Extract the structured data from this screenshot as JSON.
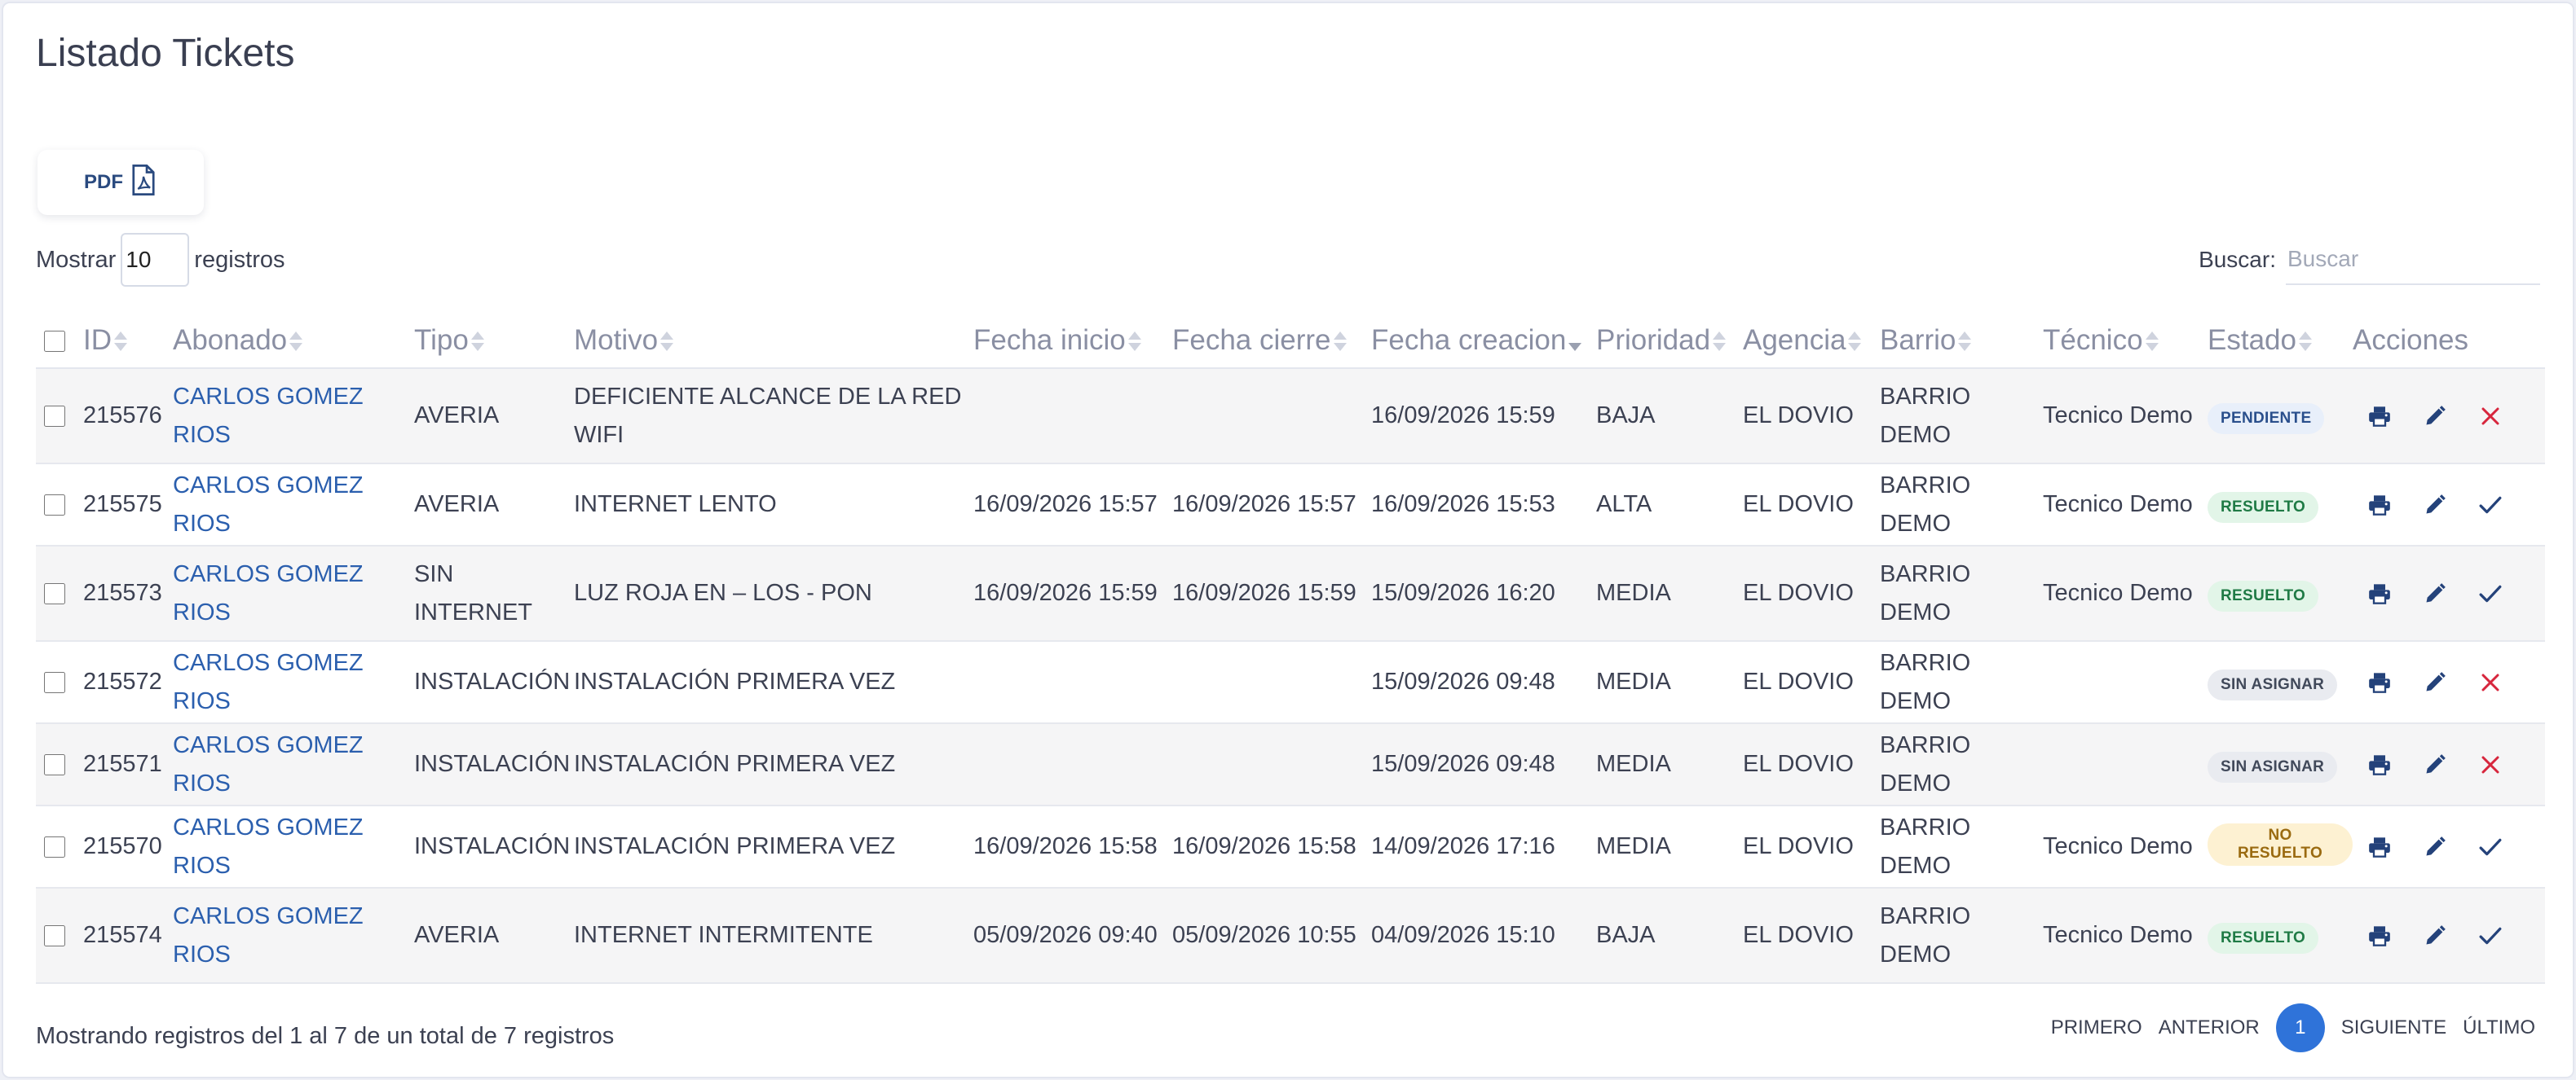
{
  "page": {
    "title": "Listado Tickets"
  },
  "toolbar": {
    "pdf_label": "PDF"
  },
  "length": {
    "prefix": "Mostrar",
    "value": "10",
    "suffix": "registros"
  },
  "search": {
    "label": "Buscar:",
    "placeholder": "Buscar"
  },
  "table": {
    "columns": [
      "ID",
      "Abonado",
      "Tipo",
      "Motivo",
      "Fecha inicio",
      "Fecha cierre",
      "Fecha creacion",
      "Prioridad",
      "Agencia",
      "Barrio",
      "Técnico",
      "Estado",
      "Acciones"
    ],
    "rows": [
      {
        "id": "215576",
        "abonado": "CARLOS GOMEZ RIOS",
        "tipo": "AVERIA",
        "motivo": "DEFICIENTE ALCANCE DE LA RED WIFI",
        "inicio": "",
        "cierre": "",
        "creacion": "16/09/2026 15:59",
        "prioridad": "BAJA",
        "agencia": "EL DOVIO",
        "barrio": "BARRIO DEMO",
        "tecnico": "Tecnico Demo",
        "estado": "PENDIENTE",
        "estado_kind": "pend",
        "accion_final": "close"
      },
      {
        "id": "215575",
        "abonado": "CARLOS GOMEZ RIOS",
        "tipo": "AVERIA",
        "motivo": "INTERNET LENTO",
        "inicio": "16/09/2026 15:57",
        "cierre": "16/09/2026 15:57",
        "creacion": "16/09/2026 15:53",
        "prioridad": "ALTA",
        "agencia": "EL DOVIO",
        "barrio": "BARRIO DEMO",
        "tecnico": "Tecnico Demo",
        "estado": "RESUELTO",
        "estado_kind": "res",
        "accion_final": "check"
      },
      {
        "id": "215573",
        "abonado": "CARLOS GOMEZ RIOS",
        "tipo": "SIN INTERNET",
        "motivo": "LUZ ROJA EN – LOS - PON",
        "inicio": "16/09/2026 15:59",
        "cierre": "16/09/2026 15:59",
        "creacion": "15/09/2026 16:20",
        "prioridad": "MEDIA",
        "agencia": "EL DOVIO",
        "barrio": "BARRIO DEMO",
        "tecnico": "Tecnico Demo",
        "estado": "RESUELTO",
        "estado_kind": "res",
        "accion_final": "check"
      },
      {
        "id": "215572",
        "abonado": "CARLOS GOMEZ RIOS",
        "tipo": "INSTALACIÓN",
        "motivo": "INSTALACIÓN PRIMERA VEZ",
        "inicio": "",
        "cierre": "",
        "creacion": "15/09/2026 09:48",
        "prioridad": "MEDIA",
        "agencia": "EL DOVIO",
        "barrio": "BARRIO DEMO",
        "tecnico": "",
        "estado": "SIN ASIGNAR",
        "estado_kind": "sin",
        "accion_final": "close"
      },
      {
        "id": "215571",
        "abonado": "CARLOS GOMEZ RIOS",
        "tipo": "INSTALACIÓN",
        "motivo": "INSTALACIÓN PRIMERA VEZ",
        "inicio": "",
        "cierre": "",
        "creacion": "15/09/2026 09:48",
        "prioridad": "MEDIA",
        "agencia": "EL DOVIO",
        "barrio": "BARRIO DEMO",
        "tecnico": "",
        "estado": "SIN ASIGNAR",
        "estado_kind": "sin",
        "accion_final": "close"
      },
      {
        "id": "215570",
        "abonado": "CARLOS GOMEZ RIOS",
        "tipo": "INSTALACIÓN",
        "motivo": "INSTALACIÓN PRIMERA VEZ",
        "inicio": "16/09/2026 15:58",
        "cierre": "16/09/2026 15:58",
        "creacion": "14/09/2026 17:16",
        "prioridad": "MEDIA",
        "agencia": "EL DOVIO",
        "barrio": "BARRIO DEMO",
        "tecnico": "Tecnico Demo",
        "estado": "NO RESUELTO",
        "estado_kind": "no",
        "accion_final": "check"
      },
      {
        "id": "215574",
        "abonado": "CARLOS GOMEZ RIOS",
        "tipo": "AVERIA",
        "motivo": "INTERNET INTERMITENTE",
        "inicio": "05/09/2026 09:40",
        "cierre": "05/09/2026 10:55",
        "creacion": "04/09/2026 15:10",
        "prioridad": "BAJA",
        "agencia": "EL DOVIO",
        "barrio": "BARRIO DEMO",
        "tecnico": "Tecnico Demo",
        "estado": "RESUELTO",
        "estado_kind": "res",
        "accion_final": "check"
      }
    ]
  },
  "footer": {
    "info": "Mostrando registros del 1 al 7 de un total de 7 registros"
  },
  "pagination": {
    "first": "PRIMERO",
    "prev": "ANTERIOR",
    "current": "1",
    "next": "SIGUIENTE",
    "last": "ÚLTIMO"
  },
  "colors": {
    "link": "#2b5fae",
    "primary": "#2f73d9",
    "danger": "#d7263d",
    "icon": "#24427a"
  }
}
